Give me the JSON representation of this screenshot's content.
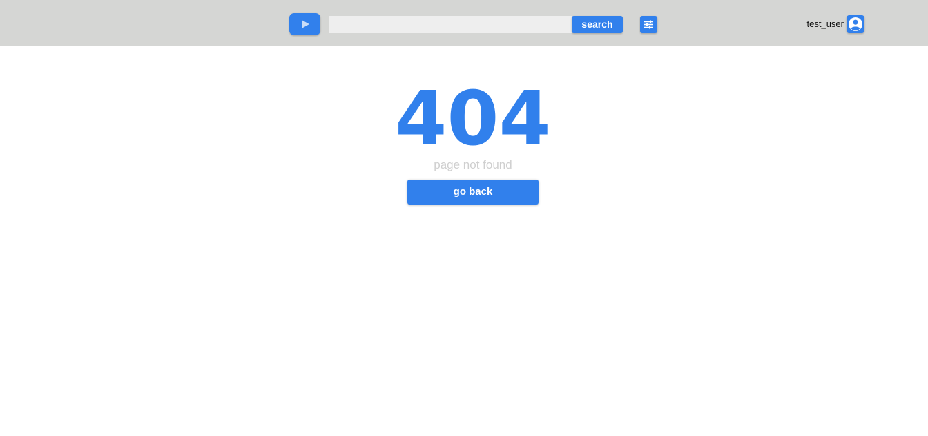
{
  "colors": {
    "accent": "#3180ec",
    "topbar_bg": "#d5d6d4",
    "search_field_bg": "#eeeeee",
    "muted_text": "#cfcfcf"
  },
  "header": {
    "logo_icon": "play-icon",
    "search": {
      "value": "",
      "placeholder": ""
    },
    "search_label": "search",
    "filter_icon": "sliders-icon",
    "username": "test_user",
    "avatar_icon": "user-circle-icon"
  },
  "main": {
    "error_code": "404",
    "error_message": "page not found",
    "go_back_label": "go back"
  }
}
